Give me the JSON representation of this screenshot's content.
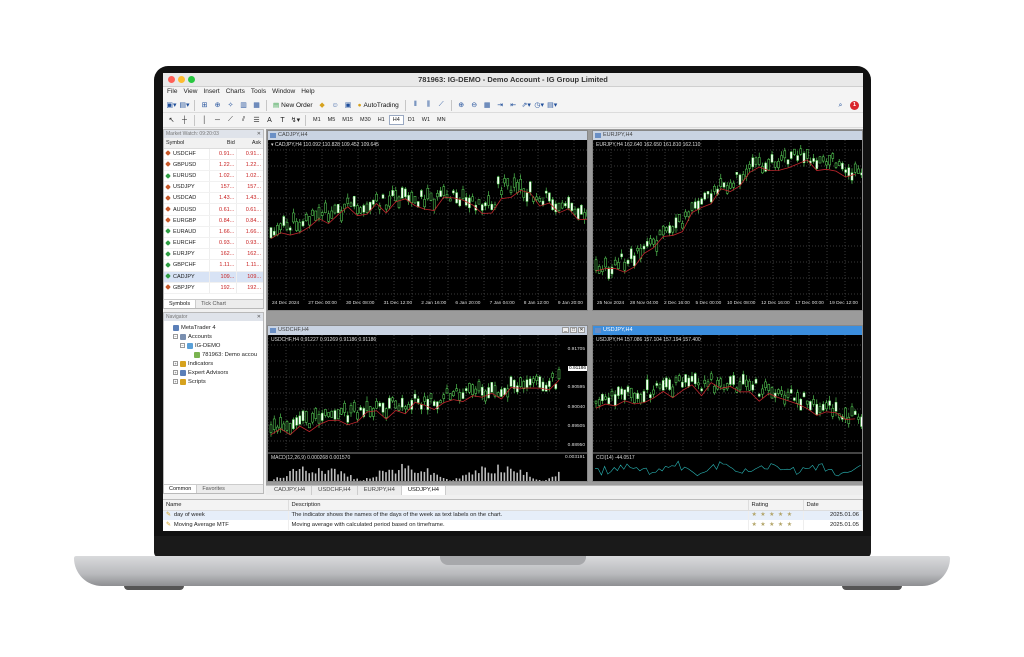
{
  "window": {
    "title": "781963: IG-DEMO - Demo Account - IG Group Limited"
  },
  "menu": [
    {
      "label": "File"
    },
    {
      "label": "View"
    },
    {
      "label": "Insert"
    },
    {
      "label": "Charts"
    },
    {
      "label": "Tools"
    },
    {
      "label": "Window"
    },
    {
      "label": "Help"
    }
  ],
  "toolbar": {
    "new_order_label": "New Order",
    "autotrading_label": "AutoTrading",
    "periods": [
      "M1",
      "M5",
      "M15",
      "M30",
      "H1",
      "H4",
      "D1",
      "W1",
      "MN"
    ],
    "active_period": "H4",
    "alert_count": "1"
  },
  "market_watch": {
    "title": "Market Watch: 09:20:03",
    "headers": {
      "symbol": "Symbol",
      "bid": "Bid",
      "ask": "Ask"
    },
    "rows": [
      {
        "symbol": "USDCHF",
        "bid": "0.91...",
        "ask": "0.91...",
        "color": "#c8592b"
      },
      {
        "symbol": "GBPUSD",
        "bid": "1.22...",
        "ask": "1.22...",
        "color": "#c8592b"
      },
      {
        "symbol": "EURUSD",
        "bid": "1.02...",
        "ask": "1.02...",
        "color": "#2f9e44"
      },
      {
        "symbol": "USDJPY",
        "bid": "157...",
        "ask": "157...",
        "color": "#c8592b"
      },
      {
        "symbol": "USDCAD",
        "bid": "1.43...",
        "ask": "1.43...",
        "color": "#c8592b"
      },
      {
        "symbol": "AUDUSD",
        "bid": "0.61...",
        "ask": "0.61...",
        "color": "#c8592b"
      },
      {
        "symbol": "EURGBP",
        "bid": "0.84...",
        "ask": "0.84...",
        "color": "#c8592b"
      },
      {
        "symbol": "EURAUD",
        "bid": "1.66...",
        "ask": "1.66...",
        "color": "#2f9e44"
      },
      {
        "symbol": "EURCHF",
        "bid": "0.93...",
        "ask": "0.93...",
        "color": "#2f9e44"
      },
      {
        "symbol": "EURJPY",
        "bid": "162...",
        "ask": "162...",
        "color": "#2f9e44"
      },
      {
        "symbol": "GBPCHF",
        "bid": "1.11...",
        "ask": "1.11...",
        "color": "#2f9e44"
      },
      {
        "symbol": "CADJPY",
        "bid": "109...",
        "ask": "109...",
        "color": "#2f9e44"
      },
      {
        "symbol": "GBPJPY",
        "bid": "192...",
        "ask": "192...",
        "color": "#c8592b"
      }
    ],
    "selected_row": 11,
    "tabs": [
      "Symbols",
      "Tick Chart"
    ]
  },
  "navigator": {
    "title": "Navigator",
    "items": [
      {
        "label": "MetaTrader 4",
        "depth": 0,
        "expander": "",
        "color": "#5b7fb8"
      },
      {
        "label": "Accounts",
        "depth": 1,
        "expander": "−",
        "color": "#7a8fb0"
      },
      {
        "label": "IG-DEMO",
        "depth": 2,
        "expander": "−",
        "color": "#5aa0d8"
      },
      {
        "label": "781963: Demo accou",
        "depth": 3,
        "expander": "",
        "color": "#7ab350"
      },
      {
        "label": "Indicators",
        "depth": 1,
        "expander": "+",
        "color": "#d6a21e"
      },
      {
        "label": "Expert Advisors",
        "depth": 1,
        "expander": "+",
        "color": "#5b7fb8"
      },
      {
        "label": "Scripts",
        "depth": 1,
        "expander": "+",
        "color": "#d6a21e"
      }
    ],
    "tabs": [
      "Common",
      "Favorites"
    ]
  },
  "charts": [
    {
      "window_title": "CADJPY,H4",
      "info": "▾ CADJPY,H4  110.092 110.828 109.452 109.645",
      "x_labels": [
        "24 Dec 2024",
        "27 Dec 00:00",
        "30 Dec 08:00",
        "31 Dec 12:00",
        "2 Jan 16:00",
        "6 Jan 20:00",
        "7 Jan 04:00",
        "8 Jan 12:00",
        "9 Jan 20:00"
      ],
      "y_labels": [],
      "active": false,
      "has_buttons": false,
      "sub": ""
    },
    {
      "window_title": "EURJPY,H4",
      "info": "EURJPY,H4  162.640 162.650 161.810 162.110",
      "x_labels": [
        "25 Nov 2024",
        "28 Nov 04:00",
        "2 Dec 16:00",
        "5 Dec 00:00",
        "10 Dec 08:00",
        "12 Dec 16:00",
        "17 Dec 00:00",
        "19 Dec 12:00"
      ],
      "y_labels": [],
      "active": false,
      "has_buttons": false,
      "sub": ""
    },
    {
      "window_title": "USDCHF,H4",
      "info": "USDCHF,H4  0.91227 0.91269 0.91186 0.91186",
      "x_labels": [],
      "y_labels": [
        "0.91705",
        "0.91186",
        "0.90595",
        "0.90040",
        "0.89505",
        "0.88950"
      ],
      "price_badge": "0.91186",
      "active": false,
      "has_buttons": true,
      "buttons": [
        "_",
        "□",
        "✕"
      ],
      "sub": "MACD(12,26,9)  0.000268 0.001570",
      "sub_label": "0.003191"
    },
    {
      "window_title": "USDJPY,H4",
      "info": "USDJPY,H4  157.086 157.104 157.194 157.400",
      "x_labels": [],
      "y_labels": [],
      "active": true,
      "has_buttons": false,
      "sub": "CCI(14) -44.0517"
    }
  ],
  "chart_tabs": [
    "CADJPY,H4",
    "USDCHF,H4",
    "EURJPY,H4",
    "USDJPY,H4"
  ],
  "active_chart_tab": 3,
  "bottom_table": {
    "headers": {
      "name": "Name",
      "description": "Description",
      "rating": "Rating",
      "date": "Date"
    },
    "rows": [
      {
        "name": "day of week",
        "description": "The indicator shows the names of the days of the week as text labels on the chart.",
        "rating": "★ ★ ★ ★ ★",
        "date": "2025.01.06"
      },
      {
        "name": "Moving Average MTF",
        "description": "Moving average with calculated period based on timeframe.",
        "rating": "★ ★ ★ ★ ★",
        "date": "2025.01.05"
      }
    ]
  }
}
